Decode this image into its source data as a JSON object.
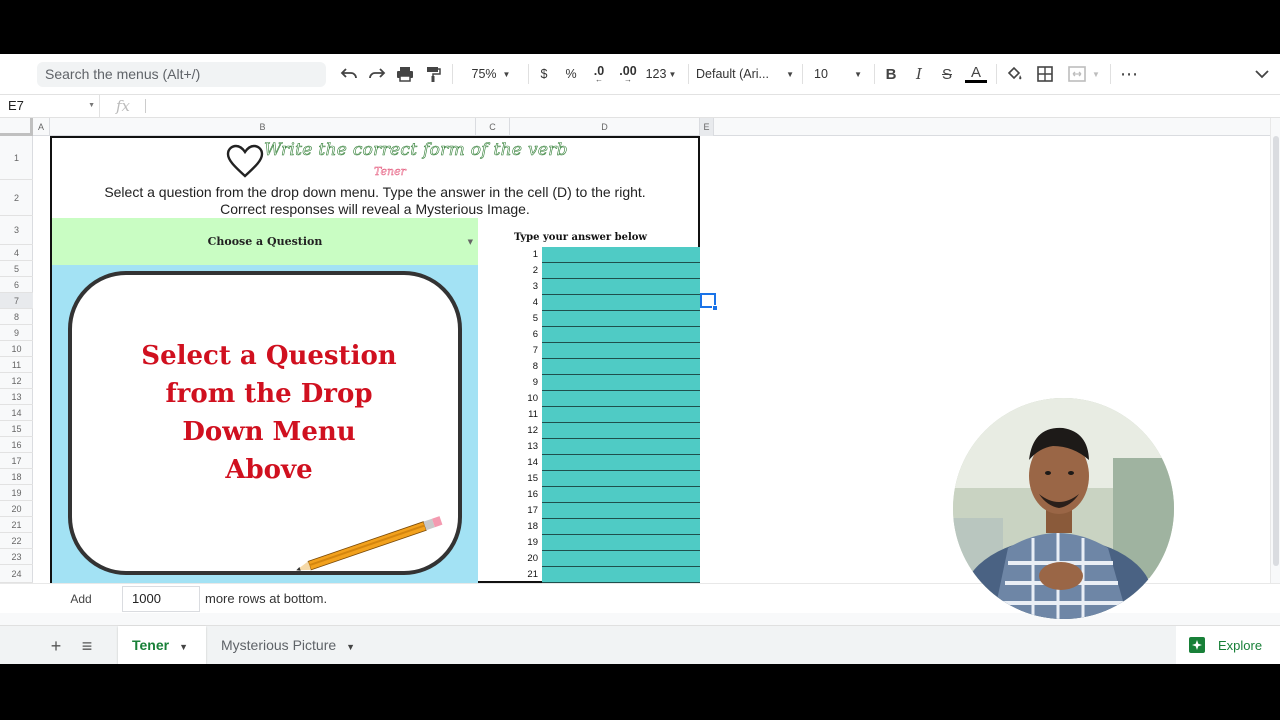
{
  "toolbar": {
    "search_placeholder": "Search the menus (Alt+/)",
    "zoom": "75%",
    "currency": "$",
    "percent": "%",
    "decrease_decimal": ".0",
    "increase_decimal": ".00",
    "number_format": "123",
    "font": "Default (Ari...",
    "font_size": "10",
    "bold": "B",
    "italic": "I",
    "strikethrough": "S",
    "text_color": "A",
    "more": "⋯"
  },
  "formula_bar": {
    "cell_ref": "E7",
    "fx": "fx",
    "value": ""
  },
  "columns": [
    "A",
    "B",
    "C",
    "D",
    "E"
  ],
  "rows": [
    "1",
    "2",
    "3",
    "4",
    "5",
    "6",
    "7",
    "8",
    "9",
    "10",
    "11",
    "12",
    "13",
    "14",
    "15",
    "16",
    "17",
    "18",
    "19",
    "20",
    "21",
    "22",
    "23",
    "24"
  ],
  "worksheet": {
    "title": "Write the correct form of the verb",
    "verb": "Tener",
    "instructions_line1": "Select a question from the drop down menu. Type the answer in the cell (D) to the right.",
    "instructions_line2": "Correct responses will reveal a Mysterious Image.",
    "choose_question": "Choose a Question",
    "prompt": [
      "Select a Question",
      "from the Drop",
      "Down Menu",
      "Above"
    ],
    "answer_header": "Type your answer below",
    "answer_numbers": [
      "1",
      "2",
      "3",
      "4",
      "5",
      "6",
      "7",
      "8",
      "9",
      "10",
      "11",
      "12",
      "13",
      "14",
      "15",
      "16",
      "17",
      "18",
      "19",
      "20",
      "21"
    ]
  },
  "add_rows": {
    "button": "Add",
    "count": "1000",
    "suffix": "more rows at bottom."
  },
  "tabs": [
    {
      "label": "Tener",
      "active": true
    },
    {
      "label": "Mysterious Picture",
      "active": false
    }
  ],
  "explore": "Explore",
  "colors": {
    "choose_bg": "#c9fdc3",
    "answer_bg": "#4fcbc5",
    "prompt_text": "#d0101f",
    "picture_bg": "#a3e2f4",
    "active_tab": "#188038"
  }
}
